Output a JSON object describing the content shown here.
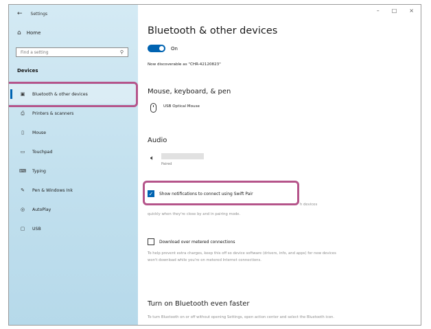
{
  "window": {
    "title": "Settings",
    "controls": {
      "minimize": "–",
      "maximize": "□",
      "close": "×"
    }
  },
  "sidebar": {
    "back_icon": "back-arrow-icon",
    "home_label": "Home",
    "search_placeholder": "Find a setting",
    "section_label": "Devices",
    "items": [
      {
        "label": "Bluetooth & other devices",
        "icon": "bluetooth-devices-icon",
        "active": true
      },
      {
        "label": "Printers & scanners",
        "icon": "printer-icon",
        "active": false
      },
      {
        "label": "Mouse",
        "icon": "mouse-icon",
        "active": false
      },
      {
        "label": "Touchpad",
        "icon": "touchpad-icon",
        "active": false
      },
      {
        "label": "Typing",
        "icon": "keyboard-icon",
        "active": false
      },
      {
        "label": "Pen & Windows Ink",
        "icon": "pen-icon",
        "active": false
      },
      {
        "label": "AutoPlay",
        "icon": "autoplay-icon",
        "active": false
      },
      {
        "label": "USB",
        "icon": "usb-icon",
        "active": false
      }
    ]
  },
  "main": {
    "title": "Bluetooth & other devices",
    "bluetooth_toggle": {
      "state_label": "On",
      "on": true
    },
    "discoverable_text": "Now discoverable as \"CHR-42120823\"",
    "mouse_section": {
      "heading": "Mouse, keyboard, & pen",
      "device_name": "USB Optical Mouse"
    },
    "audio_section": {
      "heading": "Audio",
      "device_status": "Paired"
    },
    "swift_pair": {
      "label": "Show notifications to connect using Swift Pair",
      "checked": true,
      "desc_visible_tail": "h devices",
      "desc_line2": "quickly when they're close by and in pairing mode."
    },
    "metered": {
      "label": "Download over metered connections",
      "checked": false,
      "desc": "To help prevent extra charges, keep this off so device software (drivers, info, and apps) for new devices won't download while you're on metered Internet connections."
    },
    "faster": {
      "heading": "Turn on Bluetooth even faster",
      "desc": "To turn Bluetooth on or off without opening Settings, open action center and select the Bluetooth icon."
    }
  },
  "colors": {
    "accent": "#0063b1",
    "highlight": "#b5548a",
    "sidebar_bg": "#c2e0ee"
  }
}
